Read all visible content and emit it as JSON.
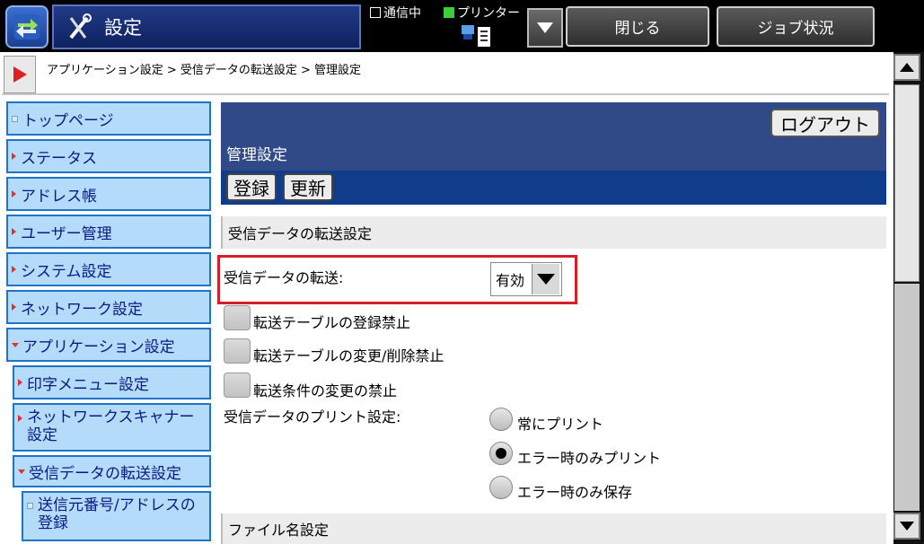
{
  "header": {
    "title": "設定",
    "status_comm": "通信中",
    "status_printer": "プリンター",
    "close_label": "閉じる",
    "job_status_label": "ジョブ状況"
  },
  "breadcrumb": "アプリケーション設定 > 受信データの転送設定 > 管理設定",
  "sidebar": {
    "items": [
      {
        "label": "トップページ"
      },
      {
        "label": "ステータス"
      },
      {
        "label": "アドレス帳"
      },
      {
        "label": "ユーザー管理"
      },
      {
        "label": "システム設定"
      },
      {
        "label": "ネットワーク設定"
      },
      {
        "label": "アプリケーション設定"
      },
      {
        "label": "印字メニュー設定"
      },
      {
        "label": "ネットワークスキャナー設定"
      },
      {
        "label": "受信データの転送設定"
      },
      {
        "label": "送信元番号/アドレスの登録"
      }
    ]
  },
  "main": {
    "logout_label": "ログアウト",
    "title": "管理設定",
    "register_label": "登録",
    "refresh_label": "更新",
    "section1": "受信データの転送設定",
    "transfer_label": "受信データの転送:",
    "transfer_value": "有効",
    "checkboxes": [
      {
        "label": "転送テーブルの登録禁止",
        "checked": false
      },
      {
        "label": "転送テーブルの変更/削除禁止",
        "checked": false
      },
      {
        "label": "転送条件の変更の禁止",
        "checked": false
      }
    ],
    "print_label": "受信データのプリント設定:",
    "radios": [
      {
        "label": "常にプリント",
        "selected": false
      },
      {
        "label": "エラー時のみプリント",
        "selected": true
      },
      {
        "label": "エラー時のみ保存",
        "selected": false
      }
    ],
    "section2": "ファイル名設定"
  },
  "colors": {
    "highlight_box": "#d32028",
    "sidebar_bg": "#b4dcfa",
    "header_bg": "#2f4a86"
  }
}
